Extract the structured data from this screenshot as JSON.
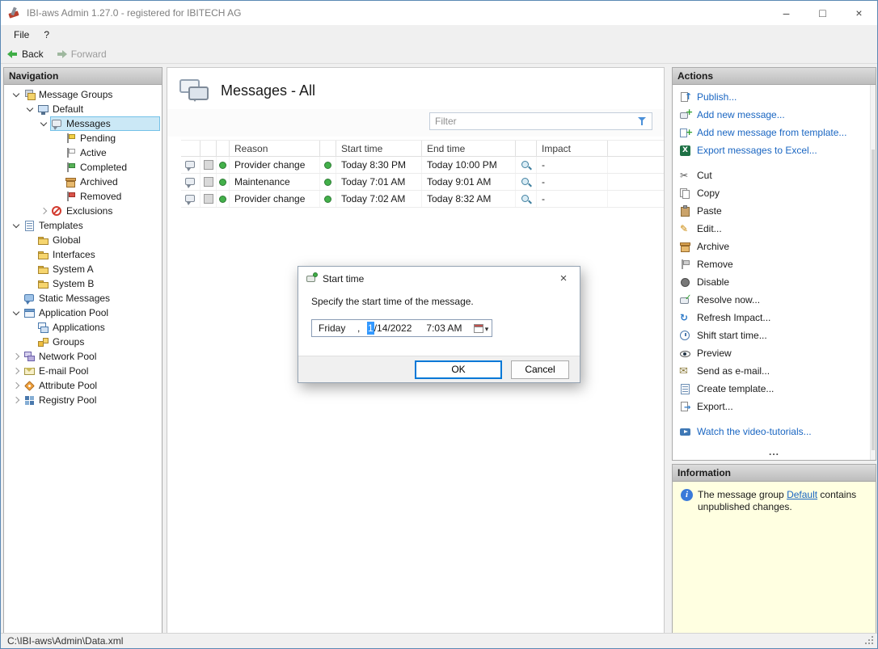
{
  "window": {
    "title": "IBI-aws Admin 1.27.0 - registered for IBITECH AG",
    "status_bar": "C:\\IBI-aws\\Admin\\Data.xml",
    "controls": {
      "minimize": "–",
      "maximize": "□",
      "close": "×"
    }
  },
  "menu": {
    "file": "File",
    "help": "?"
  },
  "toolbar": {
    "back": "Back",
    "forward": "Forward"
  },
  "navigation": {
    "header": "Navigation",
    "tree": [
      {
        "label": "Message Groups",
        "level": 0,
        "expand": "open",
        "icon": "message-groups"
      },
      {
        "label": "Default",
        "level": 1,
        "expand": "open",
        "icon": "default-group"
      },
      {
        "label": "Messages",
        "level": 2,
        "expand": "open",
        "icon": "messages-node",
        "selected": true
      },
      {
        "label": "Pending",
        "level": 3,
        "icon": "flag-yellow"
      },
      {
        "label": "Active",
        "level": 3,
        "icon": "flag-white"
      },
      {
        "label": "Completed",
        "level": 3,
        "icon": "flag-green"
      },
      {
        "label": "Archived",
        "level": 3,
        "icon": "archive-box"
      },
      {
        "label": "Removed",
        "level": 3,
        "icon": "flag-red"
      },
      {
        "label": "Exclusions",
        "level": 2,
        "expand": "closed",
        "icon": "exclusions"
      },
      {
        "label": "Templates",
        "level": 0,
        "expand": "open",
        "icon": "templates"
      },
      {
        "label": "Global",
        "level": 1,
        "icon": "folder"
      },
      {
        "label": "Interfaces",
        "level": 1,
        "icon": "folder"
      },
      {
        "label": "System A",
        "level": 1,
        "icon": "folder"
      },
      {
        "label": "System B",
        "level": 1,
        "icon": "folder"
      },
      {
        "label": "Static Messages",
        "level": 0,
        "icon": "static-messages"
      },
      {
        "label": "Application Pool",
        "level": 0,
        "expand": "open",
        "icon": "application-pool"
      },
      {
        "label": "Applications",
        "level": 1,
        "icon": "applications"
      },
      {
        "label": "Groups",
        "level": 1,
        "icon": "groups"
      },
      {
        "label": "Network Pool",
        "level": 0,
        "expand": "closed",
        "icon": "network-pool"
      },
      {
        "label": "E-mail Pool",
        "level": 0,
        "expand": "closed",
        "icon": "email-pool"
      },
      {
        "label": "Attribute Pool",
        "level": 0,
        "expand": "closed",
        "icon": "attribute-pool"
      },
      {
        "label": "Registry Pool",
        "level": 0,
        "expand": "closed",
        "icon": "registry-pool"
      }
    ]
  },
  "main": {
    "title": "Messages - All",
    "filter_placeholder": "Filter",
    "table": {
      "columns": [
        "Reason",
        "Start time",
        "End time",
        "Impact"
      ],
      "rows": [
        {
          "reason": "Provider change",
          "start": "Today 8:30 PM",
          "end": "Today 10:00 PM",
          "impact": "-"
        },
        {
          "reason": "Maintenance",
          "start": "Today 7:01 AM",
          "end": "Today 9:01 AM",
          "impact": "-"
        },
        {
          "reason": "Provider change",
          "start": "Today 7:02 AM",
          "end": "Today 8:32 AM",
          "impact": "-"
        }
      ]
    }
  },
  "dialog": {
    "title": "Start time",
    "close_glyph": "×",
    "message": "Specify the start time of the message.",
    "datetime": {
      "weekday": "Friday",
      "separator": ",",
      "month": "1",
      "date_rest": "/14/2022",
      "time": "7:03 AM"
    },
    "ok": "OK",
    "cancel": "Cancel"
  },
  "actions": {
    "header": "Actions",
    "more": "...",
    "groups": [
      {
        "style": "link",
        "items": [
          {
            "label": "Publish...",
            "icon": "publish"
          },
          {
            "label": "Add new message...",
            "icon": "add-message"
          },
          {
            "label": "Add new message from template...",
            "icon": "add-message-from-template"
          },
          {
            "label": "Export messages to Excel...",
            "icon": "export-excel"
          }
        ]
      },
      {
        "style": "normal",
        "items": [
          {
            "label": "Cut",
            "icon": "cut"
          },
          {
            "label": "Copy",
            "icon": "copy"
          },
          {
            "label": "Paste",
            "icon": "paste"
          },
          {
            "label": "Edit...",
            "icon": "edit"
          },
          {
            "label": "Archive",
            "icon": "archive-box"
          },
          {
            "label": "Remove",
            "icon": "remove-flag"
          },
          {
            "label": "Disable",
            "icon": "disable"
          },
          {
            "label": "Resolve now...",
            "icon": "resolve-now"
          },
          {
            "label": "Refresh Impact...",
            "icon": "refresh-impact"
          },
          {
            "label": "Shift start time...",
            "icon": "shift-start-time"
          },
          {
            "label": "Preview",
            "icon": "preview"
          },
          {
            "label": "Send as e-mail...",
            "icon": "send-email"
          },
          {
            "label": "Create template...",
            "icon": "create-template"
          },
          {
            "label": "Export...",
            "icon": "export"
          }
        ]
      },
      {
        "style": "link",
        "items": [
          {
            "label": "Watch the video-tutorials...",
            "icon": "video"
          }
        ]
      }
    ]
  },
  "information": {
    "header": "Information",
    "text_before": "The message group ",
    "link": "Default",
    "text_after": " contains unpublished changes."
  }
}
